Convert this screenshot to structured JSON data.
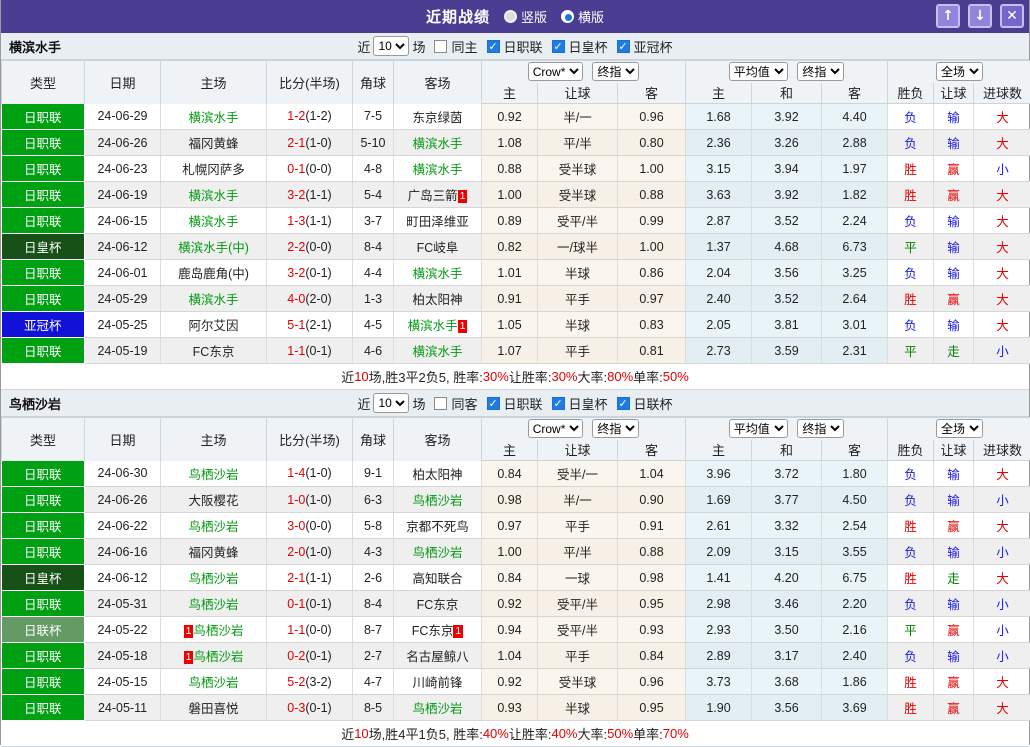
{
  "window": {
    "title": "近期战绩",
    "radios": [
      {
        "label": "竖版",
        "selected": false
      },
      {
        "label": "横版",
        "selected": true
      }
    ],
    "buttons": {
      "up": "↑",
      "down": "↓",
      "close": "✕"
    }
  },
  "columns": [
    "类型",
    "日期",
    "主场",
    "比分(半场)",
    "角球",
    "客场",
    "主",
    "让球",
    "客",
    "主",
    "和",
    "客",
    "胜负",
    "让球",
    "进球数"
  ],
  "selects": {
    "crow": "Crow*",
    "final": "终指",
    "avg": "平均值",
    "scope": "全场"
  },
  "league_colors": {
    "日职联": "#00a013",
    "日皇杯": "#175117",
    "亚冠杯": "#1111d8",
    "日联杯": "#649b64"
  },
  "text_colors": {
    "胜": "#e60000",
    "平": "#008000",
    "负": "#1a1ae6",
    "赢": "#e60000",
    "走": "#008000",
    "输": "#1a1ae6",
    "大": "#e60000",
    "小": "#1a1ae6"
  },
  "sections": [
    {
      "team": "横滨水手",
      "filter": {
        "near": "近",
        "count": "10",
        "games": "场",
        "same": "同主",
        "competitions": [
          "日职联",
          "日皇杯",
          "亚冠杯"
        ]
      },
      "rows": [
        {
          "league": "日职联",
          "date": "24-06-29",
          "home": "横滨水手",
          "home_hl": true,
          "home_badge": "",
          "score": "1-2",
          "half": "(1-2)",
          "corner": "7-5",
          "away": "东京绿茵",
          "away_hl": false,
          "away_badge": "",
          "c1": "0.92",
          "hcap": "半/一",
          "c2": "0.96",
          "a1": "1.68",
          "a2": "3.92",
          "a3": "4.40",
          "r1": "负",
          "r2": "输",
          "r3": "大"
        },
        {
          "league": "日职联",
          "date": "24-06-26",
          "home": "福冈黄蜂",
          "home_hl": false,
          "home_badge": "",
          "score": "2-1",
          "half": "(1-0)",
          "corner": "5-10",
          "away": "横滨水手",
          "away_hl": true,
          "away_badge": "",
          "c1": "1.08",
          "hcap": "平/半",
          "c2": "0.80",
          "a1": "2.36",
          "a2": "3.26",
          "a3": "2.88",
          "r1": "负",
          "r2": "输",
          "r3": "大"
        },
        {
          "league": "日职联",
          "date": "24-06-23",
          "home": "札幌冈萨多",
          "home_hl": false,
          "home_badge": "",
          "score": "0-1",
          "half": "(0-0)",
          "corner": "4-8",
          "away": "横滨水手",
          "away_hl": true,
          "away_badge": "",
          "c1": "0.88",
          "hcap": "受半球",
          "c2": "1.00",
          "a1": "3.15",
          "a2": "3.94",
          "a3": "1.97",
          "r1": "胜",
          "r2": "赢",
          "r3": "小"
        },
        {
          "league": "日职联",
          "date": "24-06-19",
          "home": "横滨水手",
          "home_hl": true,
          "home_badge": "",
          "score": "3-2",
          "half": "(1-1)",
          "corner": "5-4",
          "away": "广岛三箭",
          "away_hl": false,
          "away_badge": "1",
          "c1": "1.00",
          "hcap": "受半球",
          "c2": "0.88",
          "a1": "3.63",
          "a2": "3.92",
          "a3": "1.82",
          "r1": "胜",
          "r2": "赢",
          "r3": "大"
        },
        {
          "league": "日职联",
          "date": "24-06-15",
          "home": "横滨水手",
          "home_hl": true,
          "home_badge": "",
          "score": "1-3",
          "half": "(1-1)",
          "corner": "3-7",
          "away": "町田泽维亚",
          "away_hl": false,
          "away_badge": "",
          "c1": "0.89",
          "hcap": "受平/半",
          "c2": "0.99",
          "a1": "2.87",
          "a2": "3.52",
          "a3": "2.24",
          "r1": "负",
          "r2": "输",
          "r3": "大"
        },
        {
          "league": "日皇杯",
          "date": "24-06-12",
          "home": "横滨水手(中)",
          "home_hl": true,
          "home_badge": "",
          "score": "2-2",
          "half": "(0-0)",
          "corner": "8-4",
          "away": "FC岐阜",
          "away_hl": false,
          "away_badge": "",
          "c1": "0.82",
          "hcap": "一/球半",
          "c2": "1.00",
          "a1": "1.37",
          "a2": "4.68",
          "a3": "6.73",
          "r1": "平",
          "r2": "输",
          "r3": "大"
        },
        {
          "league": "日职联",
          "date": "24-06-01",
          "home": "鹿岛鹿角(中)",
          "home_hl": false,
          "home_badge": "",
          "score": "3-2",
          "half": "(0-1)",
          "corner": "4-4",
          "away": "横滨水手",
          "away_hl": true,
          "away_badge": "",
          "c1": "1.01",
          "hcap": "半球",
          "c2": "0.86",
          "a1": "2.04",
          "a2": "3.56",
          "a3": "3.25",
          "r1": "负",
          "r2": "输",
          "r3": "大"
        },
        {
          "league": "日职联",
          "date": "24-05-29",
          "home": "横滨水手",
          "home_hl": true,
          "home_badge": "",
          "score": "4-0",
          "half": "(2-0)",
          "corner": "1-3",
          "away": "柏太阳神",
          "away_hl": false,
          "away_badge": "",
          "c1": "0.91",
          "hcap": "平手",
          "c2": "0.97",
          "a1": "2.40",
          "a2": "3.52",
          "a3": "2.64",
          "r1": "胜",
          "r2": "赢",
          "r3": "大"
        },
        {
          "league": "亚冠杯",
          "date": "24-05-25",
          "home": "阿尔艾因",
          "home_hl": false,
          "home_badge": "",
          "score": "5-1",
          "half": "(2-1)",
          "corner": "4-5",
          "away": "横滨水手",
          "away_hl": true,
          "away_badge": "1",
          "c1": "1.05",
          "hcap": "半球",
          "c2": "0.83",
          "a1": "2.05",
          "a2": "3.81",
          "a3": "3.01",
          "r1": "负",
          "r2": "输",
          "r3": "大"
        },
        {
          "league": "日职联",
          "date": "24-05-19",
          "home": "FC东京",
          "home_hl": false,
          "home_badge": "",
          "score": "1-1",
          "half": "(0-1)",
          "corner": "4-6",
          "away": "横滨水手",
          "away_hl": true,
          "away_badge": "",
          "c1": "1.07",
          "hcap": "平手",
          "c2": "0.81",
          "a1": "2.73",
          "a2": "3.59",
          "a3": "2.31",
          "r1": "平",
          "r2": "走",
          "r3": "小"
        }
      ],
      "summary": [
        {
          "t": "近",
          "r": false
        },
        {
          "t": "10",
          "r": true
        },
        {
          "t": "场,胜3平2负5, 胜率:",
          "r": false
        },
        {
          "t": "30%",
          "r": true
        },
        {
          "t": " 让胜率:",
          "r": false
        },
        {
          "t": "30%",
          "r": true
        },
        {
          "t": " 大率:",
          "r": false
        },
        {
          "t": "80%",
          "r": true
        },
        {
          "t": " 单率:",
          "r": false
        },
        {
          "t": "50%",
          "r": true
        }
      ]
    },
    {
      "team": "鸟栖沙岩",
      "filter": {
        "near": "近",
        "count": "10",
        "games": "场",
        "same": "同客",
        "competitions": [
          "日职联",
          "日皇杯",
          "日联杯"
        ]
      },
      "rows": [
        {
          "league": "日职联",
          "date": "24-06-30",
          "home": "鸟栖沙岩",
          "home_hl": true,
          "home_badge": "",
          "score": "1-4",
          "half": "(1-0)",
          "corner": "9-1",
          "away": "柏太阳神",
          "away_hl": false,
          "away_badge": "",
          "c1": "0.84",
          "hcap": "受半/一",
          "c2": "1.04",
          "a1": "3.96",
          "a2": "3.72",
          "a3": "1.80",
          "r1": "负",
          "r2": "输",
          "r3": "大"
        },
        {
          "league": "日职联",
          "date": "24-06-26",
          "home": "大阪樱花",
          "home_hl": false,
          "home_badge": "",
          "score": "1-0",
          "half": "(1-0)",
          "corner": "6-3",
          "away": "鸟栖沙岩",
          "away_hl": true,
          "away_badge": "",
          "c1": "0.98",
          "hcap": "半/一",
          "c2": "0.90",
          "a1": "1.69",
          "a2": "3.77",
          "a3": "4.50",
          "r1": "负",
          "r2": "输",
          "r3": "小"
        },
        {
          "league": "日职联",
          "date": "24-06-22",
          "home": "鸟栖沙岩",
          "home_hl": true,
          "home_badge": "",
          "score": "3-0",
          "half": "(0-0)",
          "corner": "5-8",
          "away": "京都不死鸟",
          "away_hl": false,
          "away_badge": "",
          "c1": "0.97",
          "hcap": "平手",
          "c2": "0.91",
          "a1": "2.61",
          "a2": "3.32",
          "a3": "2.54",
          "r1": "胜",
          "r2": "赢",
          "r3": "大"
        },
        {
          "league": "日职联",
          "date": "24-06-16",
          "home": "福冈黄蜂",
          "home_hl": false,
          "home_badge": "",
          "score": "2-0",
          "half": "(1-0)",
          "corner": "4-3",
          "away": "鸟栖沙岩",
          "away_hl": true,
          "away_badge": "",
          "c1": "1.00",
          "hcap": "平/半",
          "c2": "0.88",
          "a1": "2.09",
          "a2": "3.15",
          "a3": "3.55",
          "r1": "负",
          "r2": "输",
          "r3": "小"
        },
        {
          "league": "日皇杯",
          "date": "24-06-12",
          "home": "鸟栖沙岩",
          "home_hl": true,
          "home_badge": "",
          "score": "2-1",
          "half": "(1-1)",
          "corner": "2-6",
          "away": "高知联合",
          "away_hl": false,
          "away_badge": "",
          "c1": "0.84",
          "hcap": "一球",
          "c2": "0.98",
          "a1": "1.41",
          "a2": "4.20",
          "a3": "6.75",
          "r1": "胜",
          "r2": "走",
          "r3": "大"
        },
        {
          "league": "日职联",
          "date": "24-05-31",
          "home": "鸟栖沙岩",
          "home_hl": true,
          "home_badge": "",
          "score": "0-1",
          "half": "(0-1)",
          "corner": "8-4",
          "away": "FC东京",
          "away_hl": false,
          "away_badge": "",
          "c1": "0.92",
          "hcap": "受平/半",
          "c2": "0.95",
          "a1": "2.98",
          "a2": "3.46",
          "a3": "2.20",
          "r1": "负",
          "r2": "输",
          "r3": "小"
        },
        {
          "league": "日联杯",
          "date": "24-05-22",
          "home": "鸟栖沙岩",
          "home_hl": true,
          "home_badge": "1",
          "score": "1-1",
          "half": "(0-0)",
          "corner": "8-7",
          "away": "FC东京",
          "away_hl": false,
          "away_badge": "1",
          "c1": "0.94",
          "hcap": "受平/半",
          "c2": "0.93",
          "a1": "2.93",
          "a2": "3.50",
          "a3": "2.16",
          "r1": "平",
          "r2": "赢",
          "r3": "小"
        },
        {
          "league": "日职联",
          "date": "24-05-18",
          "home": "鸟栖沙岩",
          "home_hl": true,
          "home_badge": "1",
          "score": "0-2",
          "half": "(0-1)",
          "corner": "2-7",
          "away": "名古屋鲸八",
          "away_hl": false,
          "away_badge": "",
          "c1": "1.04",
          "hcap": "平手",
          "c2": "0.84",
          "a1": "2.89",
          "a2": "3.17",
          "a3": "2.40",
          "r1": "负",
          "r2": "输",
          "r3": "小"
        },
        {
          "league": "日职联",
          "date": "24-05-15",
          "home": "鸟栖沙岩",
          "home_hl": true,
          "home_badge": "",
          "score": "5-2",
          "half": "(3-2)",
          "corner": "4-7",
          "away": "川崎前锋",
          "away_hl": false,
          "away_badge": "",
          "c1": "0.92",
          "hcap": "受半球",
          "c2": "0.96",
          "a1": "3.73",
          "a2": "3.68",
          "a3": "1.86",
          "r1": "胜",
          "r2": "赢",
          "r3": "大"
        },
        {
          "league": "日职联",
          "date": "24-05-11",
          "home": "磐田喜悦",
          "home_hl": false,
          "home_badge": "",
          "score": "0-3",
          "half": "(0-1)",
          "corner": "8-5",
          "away": "鸟栖沙岩",
          "away_hl": true,
          "away_badge": "",
          "c1": "0.93",
          "hcap": "半球",
          "c2": "0.95",
          "a1": "1.90",
          "a2": "3.56",
          "a3": "3.69",
          "r1": "胜",
          "r2": "赢",
          "r3": "大"
        }
      ],
      "summary": [
        {
          "t": "近",
          "r": false
        },
        {
          "t": "10",
          "r": true
        },
        {
          "t": "场,胜4平1负5, 胜率:",
          "r": false
        },
        {
          "t": "40%",
          "r": true
        },
        {
          "t": " 让胜率:",
          "r": false
        },
        {
          "t": "40%",
          "r": true
        },
        {
          "t": " 大率:",
          "r": false
        },
        {
          "t": "50%",
          "r": true
        },
        {
          "t": " 单率:",
          "r": false
        },
        {
          "t": "70%",
          "r": true
        }
      ]
    }
  ]
}
